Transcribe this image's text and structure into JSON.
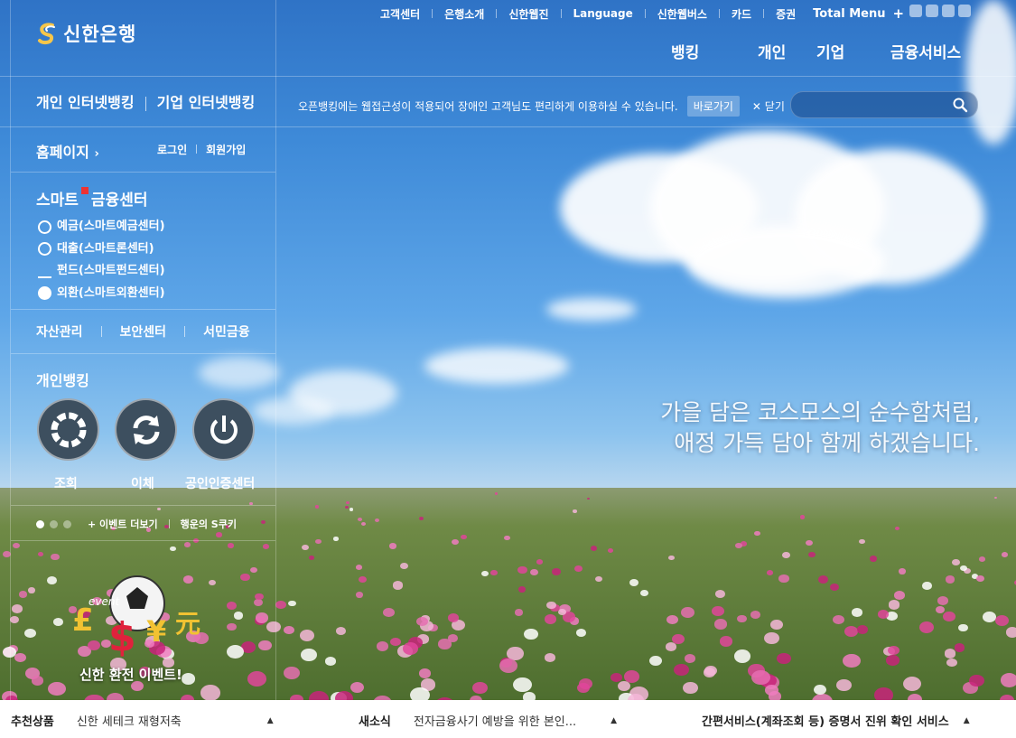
{
  "brand": {
    "name": "신한은행"
  },
  "topnav": {
    "items": [
      "고객센터",
      "은행소개",
      "신한웹진",
      "Language",
      "신한웹버스",
      "카드",
      "증권"
    ],
    "total_menu": "Total Menu",
    "plus": "+"
  },
  "mainnav": {
    "items": [
      "뱅킹",
      "개인",
      "기업",
      "금융서비스"
    ]
  },
  "notice": {
    "text": "오픈뱅킹에는 웹접근성이 적용되어 장애인 고객님도 편리하게 이용하실 수 있습니다.",
    "shortcut": "바로가기",
    "close": "닫기"
  },
  "search": {
    "placeholder": ""
  },
  "sidebar": {
    "personal_banking": "개인 인터넷뱅킹",
    "corporate_banking": "기업 인터넷뱅킹",
    "home": "홈페이지",
    "login": "로그인",
    "join": "회원가입",
    "smart_title_a": "스마트",
    "smart_title_b": "금융센터",
    "smart_items": [
      "예금(스마트예금센터)",
      "대출(스마트론센터)",
      "펀드(스마트펀드센터)",
      "외환(스마트외환센터)"
    ],
    "util": [
      "자산관리",
      "보안센터",
      "서민금융"
    ],
    "pb_title": "개인뱅킹",
    "pb_items": [
      "조회",
      "이체",
      "공인인증센터"
    ],
    "event_more": "+ 이벤트 더보기",
    "lucky_cookie": "행운의 S쿠키",
    "event_label": "신한 환전 이벤트!",
    "event_badge": "event"
  },
  "slogan": {
    "line1": "가을 담은 코스모스의 순수함처럼,",
    "line2": "애정 가득 담아 함께 하겠습니다."
  },
  "bottom": {
    "recommended_title": "추천상품",
    "recommended_text": "신한 세테크 재형저축",
    "news_title": "새소식",
    "news_text": "전자금융사기 예방을 위한 본인...",
    "quick_title": "간편서비스(계좌조회 등) 증명서 진위 확인 서비스"
  },
  "colors": {
    "sky_top": "#2f73c6",
    "sky_bottom": "#b9d7ef",
    "flower_pink": "#e0459a"
  }
}
